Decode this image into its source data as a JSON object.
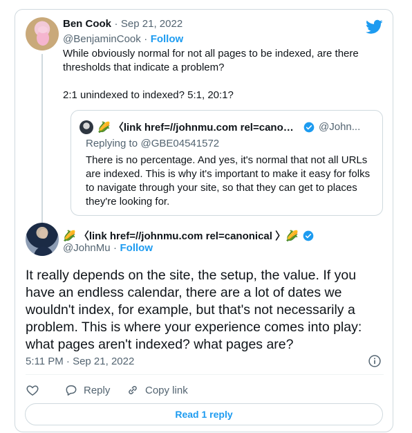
{
  "reply_tweet": {
    "author_name": "Ben Cook",
    "separator": "·",
    "date": "Sep 21, 2022",
    "handle": "@BenjaminCook",
    "follow_sep": "·",
    "follow_label": "Follow",
    "text_line1": "While obviously normal for not all pages to be indexed, are there",
    "text_line2": "thresholds that indicate a problem?",
    "text_line3": "2:1 unindexed to indexed? 5:1, 20:1?"
  },
  "quoted_tweet": {
    "author_name": "🌽 〈link href=//johnmu.com rel=canonical...",
    "handle": "@John...",
    "replying_to_label": "Replying to",
    "replying_to_handle": "@GBE04541572",
    "text_lines": [
      "There is no percentage. And yes, it's normal that not all URLs",
      "are indexed. This is why it's important to make it easy for folks",
      "to navigate through your site, so that they can get to places",
      "they're looking for."
    ]
  },
  "main_tweet": {
    "author_name": "🌽 〈link href=//johnmu.com rel=canonical 〉🌽",
    "handle": "@JohnMu",
    "follow_sep": "·",
    "follow_label": "Follow",
    "text_lines": [
      "It really depends on the site, the setup, the value. If you",
      "have an endless calendar, there are a lot of dates we",
      "wouldn't index, for example, but that's not necessarily a",
      "problem. This is where your experience comes into play:",
      "what pages aren't indexed? what pages are?"
    ],
    "timestamp": "5:11 PM · Sep 21, 2022"
  },
  "actions": {
    "reply_label": "Reply",
    "copy_link_label": "Copy link",
    "read_reply_label": "Read 1 reply"
  },
  "icons": {
    "brand": "twitter-bird-icon",
    "verified": "verified-badge-icon",
    "info": "info-icon",
    "like": "heart-icon",
    "reply": "reply-bubble-icon",
    "link": "link-icon"
  },
  "colors": {
    "accent": "#1d9bf0",
    "muted": "#536471",
    "border": "#cfd9de",
    "text": "#0f1419"
  }
}
